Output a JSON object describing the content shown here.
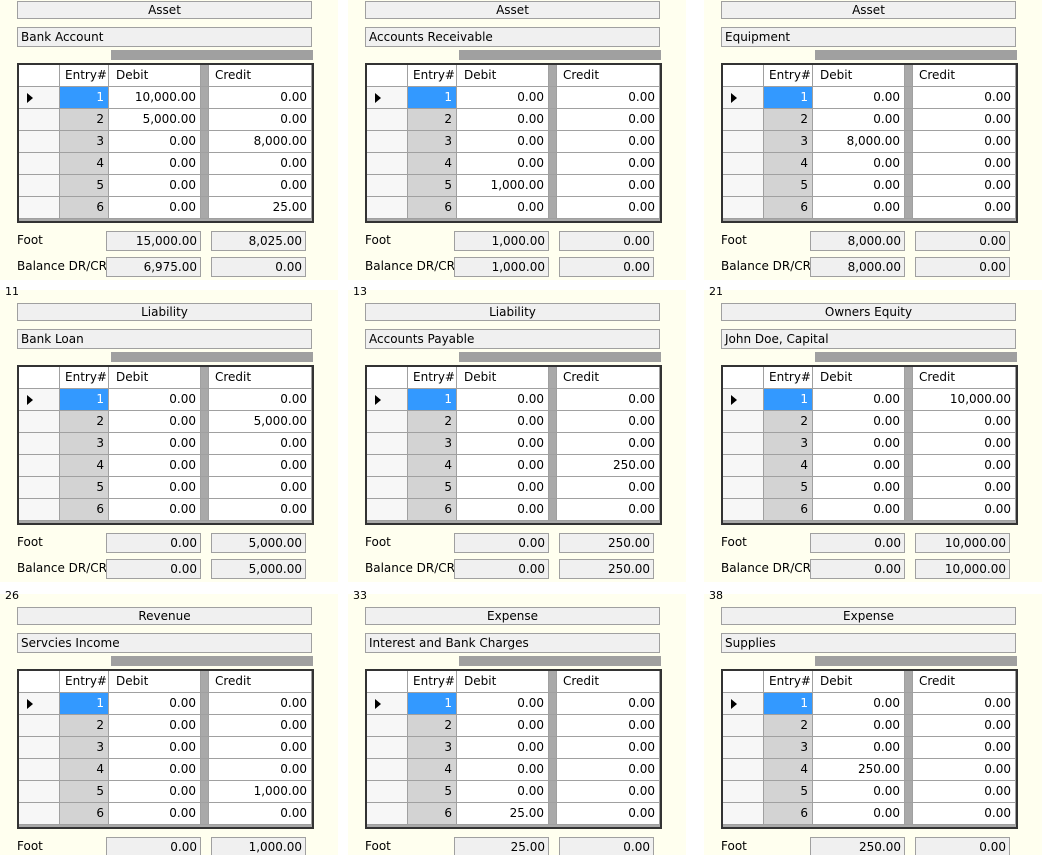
{
  "labels": {
    "entry": "Entry#",
    "debit": "Debit",
    "credit": "Credit",
    "foot": "Foot",
    "balance": "Balance DR/CR"
  },
  "accounts": [
    {
      "num": "",
      "type": "Asset",
      "name": "Bank Account",
      "rows": [
        {
          "entry": "1",
          "debit": "10,000.00",
          "credit": "0.00"
        },
        {
          "entry": "2",
          "debit": "5,000.00",
          "credit": "0.00"
        },
        {
          "entry": "3",
          "debit": "0.00",
          "credit": "8,000.00"
        },
        {
          "entry": "4",
          "debit": "0.00",
          "credit": "0.00"
        },
        {
          "entry": "5",
          "debit": "0.00",
          "credit": "0.00"
        },
        {
          "entry": "6",
          "debit": "0.00",
          "credit": "25.00"
        }
      ],
      "foot_debit": "15,000.00",
      "foot_credit": "8,025.00",
      "bal_debit": "6,975.00",
      "bal_credit": "0.00"
    },
    {
      "num": "",
      "type": "Asset",
      "name": "Accounts Receivable",
      "rows": [
        {
          "entry": "1",
          "debit": "0.00",
          "credit": "0.00"
        },
        {
          "entry": "2",
          "debit": "0.00",
          "credit": "0.00"
        },
        {
          "entry": "3",
          "debit": "0.00",
          "credit": "0.00"
        },
        {
          "entry": "4",
          "debit": "0.00",
          "credit": "0.00"
        },
        {
          "entry": "5",
          "debit": "1,000.00",
          "credit": "0.00"
        },
        {
          "entry": "6",
          "debit": "0.00",
          "credit": "0.00"
        }
      ],
      "foot_debit": "1,000.00",
      "foot_credit": "0.00",
      "bal_debit": "1,000.00",
      "bal_credit": "0.00"
    },
    {
      "num": "",
      "type": "Asset",
      "name": "Equipment",
      "rows": [
        {
          "entry": "1",
          "debit": "0.00",
          "credit": "0.00"
        },
        {
          "entry": "2",
          "debit": "0.00",
          "credit": "0.00"
        },
        {
          "entry": "3",
          "debit": "8,000.00",
          "credit": "0.00"
        },
        {
          "entry": "4",
          "debit": "0.00",
          "credit": "0.00"
        },
        {
          "entry": "5",
          "debit": "0.00",
          "credit": "0.00"
        },
        {
          "entry": "6",
          "debit": "0.00",
          "credit": "0.00"
        }
      ],
      "foot_debit": "8,000.00",
      "foot_credit": "0.00",
      "bal_debit": "8,000.00",
      "bal_credit": "0.00"
    },
    {
      "num": "11",
      "type": "Liability",
      "name": "Bank Loan",
      "rows": [
        {
          "entry": "1",
          "debit": "0.00",
          "credit": "0.00"
        },
        {
          "entry": "2",
          "debit": "0.00",
          "credit": "5,000.00"
        },
        {
          "entry": "3",
          "debit": "0.00",
          "credit": "0.00"
        },
        {
          "entry": "4",
          "debit": "0.00",
          "credit": "0.00"
        },
        {
          "entry": "5",
          "debit": "0.00",
          "credit": "0.00"
        },
        {
          "entry": "6",
          "debit": "0.00",
          "credit": "0.00"
        }
      ],
      "foot_debit": "0.00",
      "foot_credit": "5,000.00",
      "bal_debit": "0.00",
      "bal_credit": "5,000.00"
    },
    {
      "num": "13",
      "type": "Liability",
      "name": "Accounts Payable",
      "rows": [
        {
          "entry": "1",
          "debit": "0.00",
          "credit": "0.00"
        },
        {
          "entry": "2",
          "debit": "0.00",
          "credit": "0.00"
        },
        {
          "entry": "3",
          "debit": "0.00",
          "credit": "0.00"
        },
        {
          "entry": "4",
          "debit": "0.00",
          "credit": "250.00"
        },
        {
          "entry": "5",
          "debit": "0.00",
          "credit": "0.00"
        },
        {
          "entry": "6",
          "debit": "0.00",
          "credit": "0.00"
        }
      ],
      "foot_debit": "0.00",
      "foot_credit": "250.00",
      "bal_debit": "0.00",
      "bal_credit": "250.00"
    },
    {
      "num": "21",
      "type": "Owners Equity",
      "name": "John Doe, Capital",
      "rows": [
        {
          "entry": "1",
          "debit": "0.00",
          "credit": "10,000.00"
        },
        {
          "entry": "2",
          "debit": "0.00",
          "credit": "0.00"
        },
        {
          "entry": "3",
          "debit": "0.00",
          "credit": "0.00"
        },
        {
          "entry": "4",
          "debit": "0.00",
          "credit": "0.00"
        },
        {
          "entry": "5",
          "debit": "0.00",
          "credit": "0.00"
        },
        {
          "entry": "6",
          "debit": "0.00",
          "credit": "0.00"
        }
      ],
      "foot_debit": "0.00",
      "foot_credit": "10,000.00",
      "bal_debit": "0.00",
      "bal_credit": "10,000.00"
    },
    {
      "num": "26",
      "type": "Revenue",
      "name": "Servcies Income",
      "rows": [
        {
          "entry": "1",
          "debit": "0.00",
          "credit": "0.00"
        },
        {
          "entry": "2",
          "debit": "0.00",
          "credit": "0.00"
        },
        {
          "entry": "3",
          "debit": "0.00",
          "credit": "0.00"
        },
        {
          "entry": "4",
          "debit": "0.00",
          "credit": "0.00"
        },
        {
          "entry": "5",
          "debit": "0.00",
          "credit": "1,000.00"
        },
        {
          "entry": "6",
          "debit": "0.00",
          "credit": "0.00"
        }
      ],
      "foot_debit": "0.00",
      "foot_credit": "1,000.00",
      "bal_debit": "",
      "bal_credit": ""
    },
    {
      "num": "33",
      "type": "Expense",
      "name": "Interest and Bank Charges",
      "rows": [
        {
          "entry": "1",
          "debit": "0.00",
          "credit": "0.00"
        },
        {
          "entry": "2",
          "debit": "0.00",
          "credit": "0.00"
        },
        {
          "entry": "3",
          "debit": "0.00",
          "credit": "0.00"
        },
        {
          "entry": "4",
          "debit": "0.00",
          "credit": "0.00"
        },
        {
          "entry": "5",
          "debit": "0.00",
          "credit": "0.00"
        },
        {
          "entry": "6",
          "debit": "25.00",
          "credit": "0.00"
        }
      ],
      "foot_debit": "25.00",
      "foot_credit": "0.00",
      "bal_debit": "",
      "bal_credit": ""
    },
    {
      "num": "38",
      "type": "Expense",
      "name": "Supplies",
      "rows": [
        {
          "entry": "1",
          "debit": "0.00",
          "credit": "0.00"
        },
        {
          "entry": "2",
          "debit": "0.00",
          "credit": "0.00"
        },
        {
          "entry": "3",
          "debit": "0.00",
          "credit": "0.00"
        },
        {
          "entry": "4",
          "debit": "250.00",
          "credit": "0.00"
        },
        {
          "entry": "5",
          "debit": "0.00",
          "credit": "0.00"
        },
        {
          "entry": "6",
          "debit": "0.00",
          "credit": "0.00"
        }
      ],
      "foot_debit": "250.00",
      "foot_credit": "0.00",
      "bal_debit": "",
      "bal_credit": ""
    }
  ]
}
